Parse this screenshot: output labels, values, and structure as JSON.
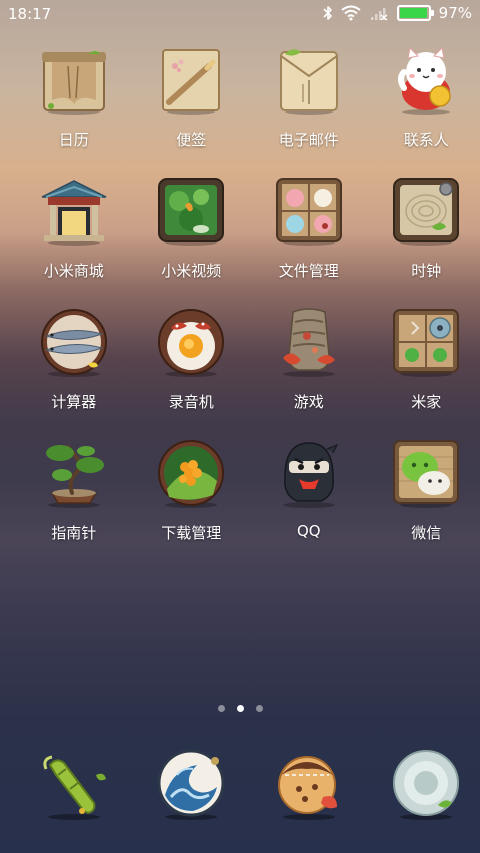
{
  "status_bar": {
    "time": "18:17",
    "battery_percent_text": "97%",
    "battery_level": 0.97,
    "battery_color": "#39d64a",
    "icons": [
      "bluetooth-icon",
      "wifi-icon",
      "no-signal-icon",
      "battery-icon"
    ]
  },
  "apps": [
    {
      "label": "日历",
      "icon": "calendar-icon"
    },
    {
      "label": "便签",
      "icon": "notes-icon"
    },
    {
      "label": "电子邮件",
      "icon": "email-icon"
    },
    {
      "label": "联系人",
      "icon": "contacts-icon"
    },
    {
      "label": "小米商城",
      "icon": "mi-store-icon"
    },
    {
      "label": "小米视频",
      "icon": "mi-video-icon"
    },
    {
      "label": "文件管理",
      "icon": "file-manager-icon"
    },
    {
      "label": "时钟",
      "icon": "clock-icon"
    },
    {
      "label": "计算器",
      "icon": "calculator-icon"
    },
    {
      "label": "录音机",
      "icon": "recorder-icon"
    },
    {
      "label": "游戏",
      "icon": "games-icon"
    },
    {
      "label": "米家",
      "icon": "mijia-icon"
    },
    {
      "label": "指南针",
      "icon": "compass-icon"
    },
    {
      "label": "下载管理",
      "icon": "downloads-icon"
    },
    {
      "label": "QQ",
      "icon": "qq-icon"
    },
    {
      "label": "微信",
      "icon": "wechat-icon"
    }
  ],
  "page_indicator": {
    "count": 3,
    "active_index": 1
  },
  "dock": [
    {
      "icon": "phone-icon"
    },
    {
      "icon": "messages-icon"
    },
    {
      "icon": "browser-icon"
    },
    {
      "icon": "camera-icon"
    }
  ]
}
